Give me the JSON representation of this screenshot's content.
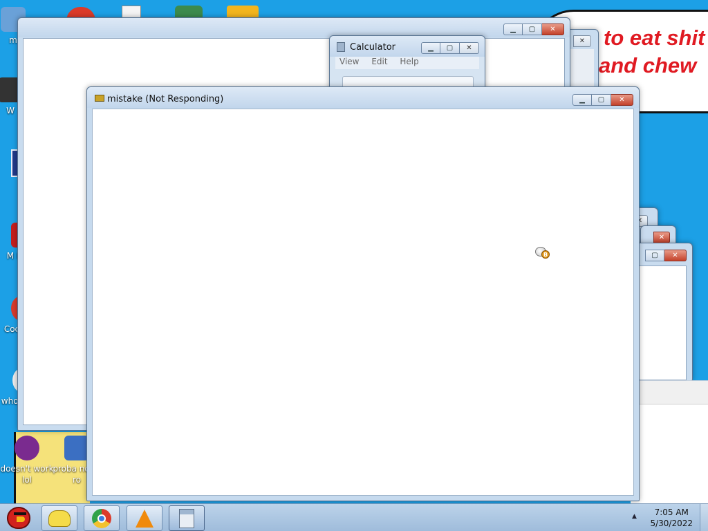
{
  "desktop": {
    "icons": [
      {
        "label": "m",
        "color": "#6aa1d8"
      },
      {
        "label": "W",
        "color": "#333333"
      },
      {
        "label": "M R",
        "color": "#c41e1e"
      },
      {
        "label": "Coc",
        "color": "#d83a2c"
      },
      {
        "label": "who us",
        "color": "#eeeeee"
      },
      {
        "label": "doesn't work lol",
        "color": "#7a2b8f"
      },
      {
        "label": "proba not a ro",
        "color": "#3b6fc2"
      }
    ],
    "speech_bubble": {
      "line1": "to eat shit",
      "line2": "and chew"
    }
  },
  "windows": {
    "back_window": {
      "title": ""
    },
    "calculator": {
      "title": "Calculator",
      "menu": [
        "View",
        "Edit",
        "Help"
      ]
    },
    "mistake": {
      "title": "mistake (Not Responding)"
    }
  },
  "controls": {
    "minimize": "▁",
    "maximize": "▢",
    "close": "✕"
  },
  "taskbar": {
    "start_icon": "angry-bird-icon",
    "buttons": [
      "folder-chick-icon",
      "chrome-icon",
      "vlc-icon",
      "calculator-icon"
    ],
    "tray_arrow": "▲",
    "time": "7:05 AM",
    "date": "5/30/2022"
  },
  "cursor": "busy-cursor-icon"
}
